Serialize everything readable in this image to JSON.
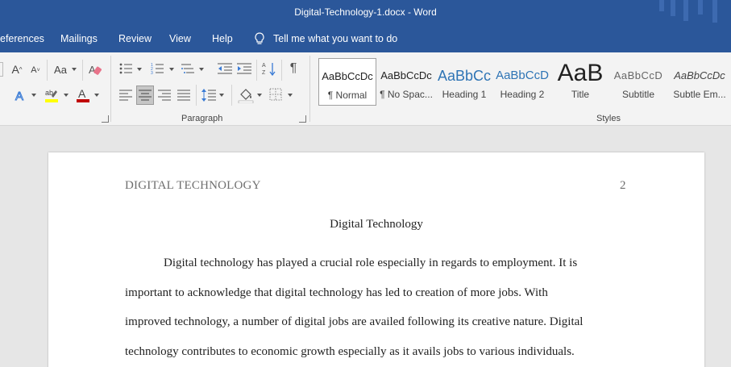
{
  "window": {
    "title": "Digital-Technology-1.docx  -  Word"
  },
  "menu": {
    "tabs": [
      {
        "label": "eferences"
      },
      {
        "label": "Mailings"
      },
      {
        "label": "Review"
      },
      {
        "label": "View"
      },
      {
        "label": "Help"
      }
    ],
    "tell_me": "Tell me what you want to do"
  },
  "ribbon": {
    "font_group": {
      "change_case_label": "Aa"
    },
    "paragraph_group": {
      "label": "Paragraph"
    },
    "styles_group": {
      "label": "Styles",
      "styles": [
        {
          "sample": "AaBbCcDc",
          "name": "¶ Normal",
          "selected": true
        },
        {
          "sample": "AaBbCcDc",
          "name": "¶ No Spac..."
        },
        {
          "sample": "AaBbCc",
          "name": "Heading 1"
        },
        {
          "sample": "AaBbCcD",
          "name": "Heading 2"
        },
        {
          "sample": "AaB",
          "name": "Title"
        },
        {
          "sample": "AaBbCcD",
          "name": "Subtitle"
        },
        {
          "sample": "AaBbCcDc",
          "name": "Subtle Em..."
        }
      ]
    },
    "colors": {
      "highlight": "#ffff00",
      "font_color": "#c00000",
      "accent": "#2b579a"
    }
  },
  "document": {
    "running_head": "DIGITAL TECHNOLOGY",
    "page_number": "2",
    "title": "Digital Technology",
    "lines": [
      "Digital technology has played a crucial role especially in regards to employment. It is",
      "important to acknowledge that digital technology has led to creation of more jobs. With",
      "improved technology, a number of digital jobs are availed following its creative nature. Digital",
      "technology contributes to economic growth especially as it avails jobs to various individuals."
    ]
  }
}
